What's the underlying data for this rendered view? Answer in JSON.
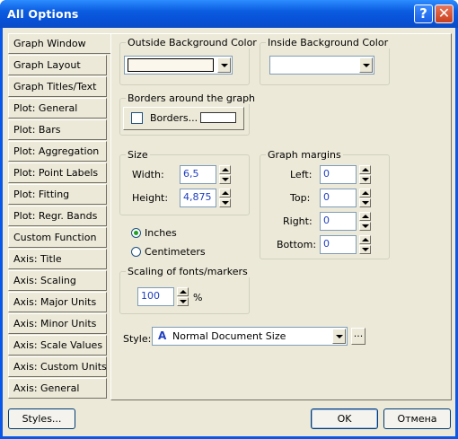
{
  "window": {
    "title": "All Options",
    "help_glyph": "?",
    "close_glyph": "✕"
  },
  "nav": {
    "items": [
      {
        "label": "Graph Window",
        "active": true
      },
      {
        "label": "Graph Layout"
      },
      {
        "label": "Graph Titles/Text"
      },
      {
        "label": "Plot: General"
      },
      {
        "label": "Plot: Bars"
      },
      {
        "label": "Plot: Aggregation"
      },
      {
        "label": "Plot: Point Labels"
      },
      {
        "label": "Plot: Fitting"
      },
      {
        "label": "Plot: Regr. Bands"
      },
      {
        "label": "Custom Function"
      },
      {
        "label": "Axis: Title"
      },
      {
        "label": "Axis: Scaling"
      },
      {
        "label": "Axis: Major Units"
      },
      {
        "label": "Axis: Minor Units"
      },
      {
        "label": "Axis: Scale Values"
      },
      {
        "label": "Axis: Custom Units"
      },
      {
        "label": "Axis: General"
      }
    ]
  },
  "outside_bg": {
    "label": "Outside Background Color",
    "value_color": "#fbf7ec"
  },
  "inside_bg": {
    "label": "Inside Background Color",
    "value_color": "#ffffff"
  },
  "borders": {
    "group_label": "Borders around the graph",
    "button_label": "Borders...",
    "checked": false
  },
  "size": {
    "group_label": "Size",
    "width_label": "Width:",
    "width_value": "6,5",
    "height_label": "Height:",
    "height_value": "4,875"
  },
  "margins": {
    "group_label": "Graph margins",
    "left_label": "Left:",
    "left_value": "0",
    "top_label": "Top:",
    "top_value": "0",
    "right_label": "Right:",
    "right_value": "0",
    "bottom_label": "Bottom:",
    "bottom_value": "0"
  },
  "units": {
    "inches_label": "Inches",
    "centimeters_label": "Centimeters",
    "selected": "Inches"
  },
  "scaling": {
    "group_label": "Scaling of fonts/markers",
    "value": "100",
    "unit": "%"
  },
  "style": {
    "label": "Style:",
    "value": "Normal Document Size",
    "font_glyph": "A",
    "more_label": "..."
  },
  "footer": {
    "styles_label": "Styles...",
    "ok_label": "OK",
    "cancel_label": "Отмена"
  }
}
